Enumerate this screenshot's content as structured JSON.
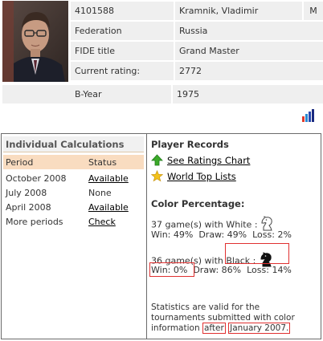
{
  "profile": {
    "id": "4101588",
    "name": "Kramnik, Vladimir",
    "sex": "M",
    "federation_label": "Federation",
    "federation_value": "Russia",
    "fide_title_label": "FIDE title",
    "fide_title_value": "Grand Master",
    "rating_label": "Current rating:",
    "rating_value": "2772",
    "byear_label": "B-Year",
    "byear_value": "1975"
  },
  "calculations": {
    "title": "Individual Calculations",
    "col_period": "Period",
    "col_status": "Status",
    "rows": [
      {
        "period": "October 2008",
        "status": "Available"
      },
      {
        "period": "July 2008",
        "status": "None"
      },
      {
        "period": "April 2008",
        "status": "Available"
      },
      {
        "period": "More periods",
        "status": "Check"
      }
    ]
  },
  "records": {
    "title": "Player Records",
    "ratings_chart_link": "See Ratings Chart",
    "world_top_link": "World Top Lists",
    "color_title": "Color Percentage:",
    "white_games": "37 game(s) with White :",
    "white_win": "Win: 49%",
    "white_draw": "Draw: 49%",
    "white_loss": "Loss: 2%",
    "black_games_prefix": "36 game(s) with",
    "black_games_word": "Black :",
    "black_win": "Win: 0%",
    "black_draw": "Draw: 86%",
    "black_loss": "Loss: 14%",
    "note_text": "Statistics are valid for the tournaments submitted with color information",
    "note_after": "after",
    "note_date": "January 2007."
  },
  "icons": {
    "chart_icon": "bar-chart-icon",
    "up_arrow": "green-up-arrow-icon",
    "star": "gold-star-icon",
    "white_knight": "white-knight-icon",
    "black_knight": "black-knight-icon"
  },
  "colors": {
    "table_bg": "#efefef",
    "header_bg": "#f9dcc0",
    "highlight": "#e03030"
  }
}
